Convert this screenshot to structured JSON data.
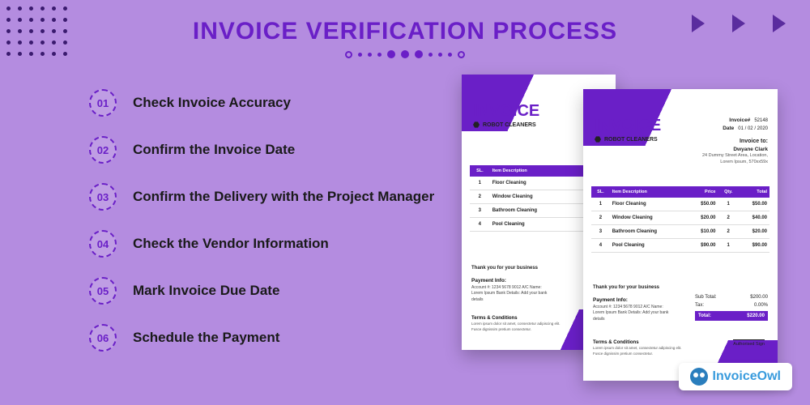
{
  "title": "INVOICE VERIFICATION PROCESS",
  "steps": [
    {
      "num": "01",
      "label": "Check Invoice Accuracy"
    },
    {
      "num": "02",
      "label": "Confirm the Invoice Date"
    },
    {
      "num": "03",
      "label": "Confirm the Delivery with the Project Manager"
    },
    {
      "num": "04",
      "label": "Check the Vendor Information"
    },
    {
      "num": "05",
      "label": "Mark Invoice Due Date"
    },
    {
      "num": "06",
      "label": "Schedule the Payment"
    }
  ],
  "invoice": {
    "title": "INVOICE",
    "company": "ROBOT CLEANERS",
    "meta_invoice_label": "Invoice#",
    "meta_invoice_no": "52148",
    "meta_date_label": "Date",
    "meta_date": "01 / 02 / 2020",
    "bill_to_heading": "Invoice to:",
    "bill_to_name": "Dwyane Clark",
    "bill_to_addr": "24 Dummy Street Area, Location, Lorem Ipsum, 570xx59x",
    "columns": {
      "sl": "SL.",
      "desc": "Item Description",
      "price": "Price",
      "qty": "Qty.",
      "total": "Total"
    },
    "rows": [
      {
        "sl": "1",
        "desc": "Floor Cleaning",
        "price": "$50.00",
        "qty": "1",
        "total": "$50.00"
      },
      {
        "sl": "2",
        "desc": "Window Cleaning",
        "price": "$20.00",
        "qty": "2",
        "total": "$40.00"
      },
      {
        "sl": "3",
        "desc": "Bathroom Cleaning",
        "price": "$10.00",
        "qty": "2",
        "total": "$20.00"
      },
      {
        "sl": "4",
        "desc": "Pool Cleaning",
        "price": "$90.00",
        "qty": "1",
        "total": "$90.00"
      }
    ],
    "thanks": "Thank you for your business",
    "payment_heading": "Payment Info:",
    "payment_lines": "Account #:   1234 5678 9012\nA/C Name:    Lorem Ipsum\nBank Details:  Add your bank details",
    "terms_heading": "Terms & Conditions",
    "terms_body": "Lorem ipsum dolor sit amet, consectetur adipiscing elit. Fusce dignissim pretium consectetur.",
    "subtotal_label": "Sub Total:",
    "subtotal": "$200.00",
    "tax_label": "Tax:",
    "tax": "0.00%",
    "total_label": "Total:",
    "total": "$220.00",
    "sign_label": "Authorised Sign"
  },
  "brand": {
    "name1": "Invoice",
    "name2": "Owl"
  }
}
